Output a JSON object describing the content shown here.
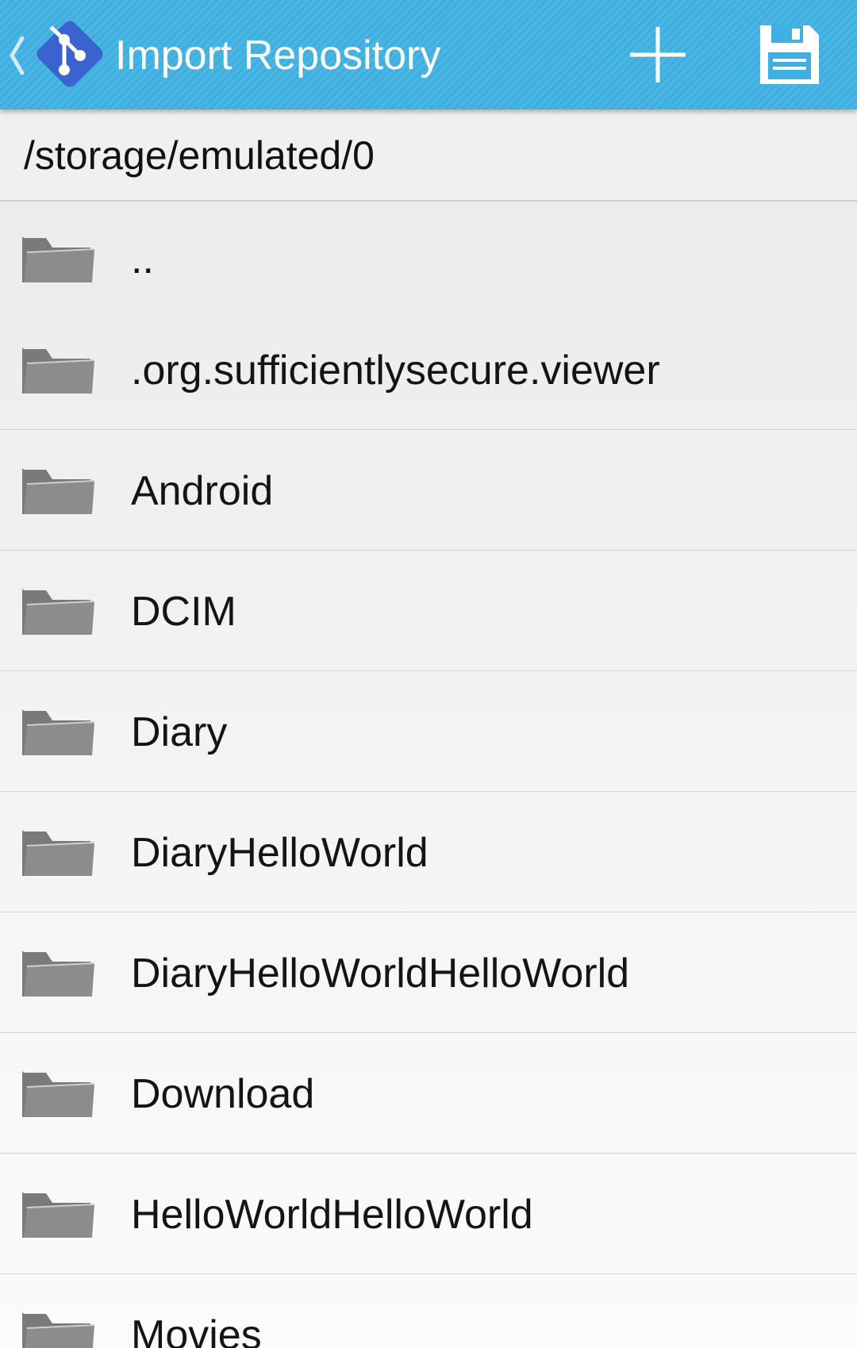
{
  "action_bar": {
    "title": "Import Repository",
    "icons": {
      "up": "chevron-left-icon",
      "logo": "git-logo-icon",
      "add": "plus-icon",
      "save": "floppy-disk-icon"
    },
    "colors": {
      "bar_background": "#3fb0e0",
      "logo": "#3b63cf",
      "icons": "#ffffff"
    }
  },
  "current_path": "/storage/emulated/0",
  "files": [
    {
      "name": ".."
    },
    {
      "name": ".org.sufficientlysecure.viewer"
    },
    {
      "name": "Android"
    },
    {
      "name": "DCIM"
    },
    {
      "name": "Diary"
    },
    {
      "name": "DiaryHelloWorld"
    },
    {
      "name": "DiaryHelloWorldHelloWorld"
    },
    {
      "name": "Download"
    },
    {
      "name": "HelloWorldHelloWorld"
    },
    {
      "name": "Movies"
    }
  ],
  "folder_icon": "folder-icon",
  "folder_icon_color": "#7a7a7a"
}
